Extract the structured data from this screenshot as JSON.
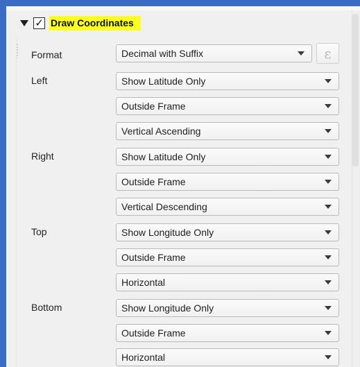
{
  "group": {
    "checked_mark": "✓",
    "title": "Draw Coordinates"
  },
  "format": {
    "label": "Format",
    "value": "Decimal with Suffix",
    "expression_symbol": "ε"
  },
  "left": {
    "label": "Left",
    "display": "Show Latitude Only",
    "position": "Outside Frame",
    "direction": "Vertical Ascending"
  },
  "right": {
    "label": "Right",
    "display": "Show Latitude Only",
    "position": "Outside Frame",
    "direction": "Vertical Descending"
  },
  "top": {
    "label": "Top",
    "display": "Show Longitude Only",
    "position": "Outside Frame",
    "direction": "Horizontal"
  },
  "bottom": {
    "label": "Bottom",
    "display": "Show Longitude Only",
    "position": "Outside Frame",
    "direction": "Horizontal"
  },
  "colors": {
    "title_highlight": "#fbff21",
    "window_frame": "#3b6cc4"
  }
}
